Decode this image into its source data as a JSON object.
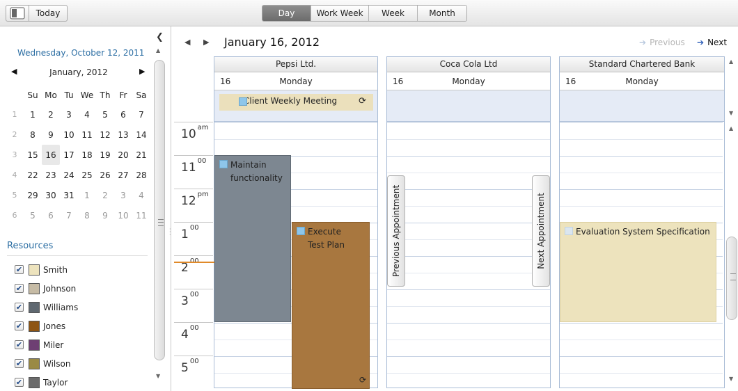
{
  "toolbar": {
    "today_label": "Today",
    "views": [
      {
        "label": "Day",
        "selected": true
      },
      {
        "label": "Work Week",
        "selected": false
      },
      {
        "label": "Week",
        "selected": false
      },
      {
        "label": "Month",
        "selected": false
      }
    ]
  },
  "sidebar": {
    "current_date": "Wednesday, October 12, 2011",
    "mini_calendar": {
      "month_label": "January, 2012",
      "weekday_headers": [
        "Su",
        "Mo",
        "Tu",
        "We",
        "Th",
        "Fr",
        "Sa"
      ],
      "weeks": [
        {
          "num": "1",
          "days": [
            "1",
            "2",
            "3",
            "4",
            "5",
            "6",
            "7"
          ]
        },
        {
          "num": "2",
          "days": [
            "8",
            "9",
            "10",
            "11",
            "12",
            "13",
            "14"
          ]
        },
        {
          "num": "3",
          "days": [
            "15",
            "16",
            "17",
            "18",
            "19",
            "20",
            "21"
          ]
        },
        {
          "num": "4",
          "days": [
            "22",
            "23",
            "24",
            "25",
            "26",
            "27",
            "28"
          ]
        },
        {
          "num": "5",
          "days": [
            "29",
            "30",
            "31",
            "1",
            "2",
            "3",
            "4"
          ]
        },
        {
          "num": "6",
          "days": [
            "5",
            "6",
            "7",
            "8",
            "9",
            "10",
            "11"
          ]
        }
      ],
      "selected_day": "16"
    },
    "resources_title": "Resources",
    "resources": [
      {
        "name": "Smith",
        "color": "#ede3bd",
        "checked": true
      },
      {
        "name": "Johnson",
        "color": "#c6bba5",
        "checked": true
      },
      {
        "name": "Williams",
        "color": "#5f6870",
        "checked": true
      },
      {
        "name": "Jones",
        "color": "#8e5513",
        "checked": true
      },
      {
        "name": "Miler",
        "color": "#6e3f73",
        "checked": true
      },
      {
        "name": "Wilson",
        "color": "#9a8a44",
        "checked": true
      },
      {
        "name": "Taylor",
        "color": "#6b6b6b",
        "checked": true
      }
    ]
  },
  "main": {
    "date_title": "January 16, 2012",
    "previous_label": "Previous",
    "next_label": "Next",
    "time_slots": [
      {
        "hour": "10",
        "suffix": "am"
      },
      {
        "hour": "11",
        "suffix": "00"
      },
      {
        "hour": "12",
        "suffix": "pm"
      },
      {
        "hour": "1",
        "suffix": "00"
      },
      {
        "hour": "2",
        "suffix": "00"
      },
      {
        "hour": "3",
        "suffix": "00"
      },
      {
        "hour": "4",
        "suffix": "00"
      },
      {
        "hour": "5",
        "suffix": "00"
      }
    ],
    "groups": [
      {
        "name": "Pepsi Ltd.",
        "day_num": "16",
        "day_name": "Monday"
      },
      {
        "name": "Coca Cola Ltd",
        "day_num": "16",
        "day_name": "Monday"
      },
      {
        "name": "Standard Chartered Bank",
        "day_num": "16",
        "day_name": "Monday"
      }
    ],
    "allday_appointment": {
      "title": "Client Weekly Meeting"
    },
    "appointments": {
      "maintain": {
        "line1": "Maintain",
        "line2": "functionality",
        "color": "#7d8791"
      },
      "execute": {
        "line1": "Execute",
        "line2": "Test Plan",
        "color": "#a8773f"
      },
      "evaluation": {
        "title": "Evaluation System Specification",
        "color": "#ede3bd"
      }
    },
    "previous_appointment_label": "Previous Appointment",
    "next_appointment_label": "Next Appointment"
  }
}
